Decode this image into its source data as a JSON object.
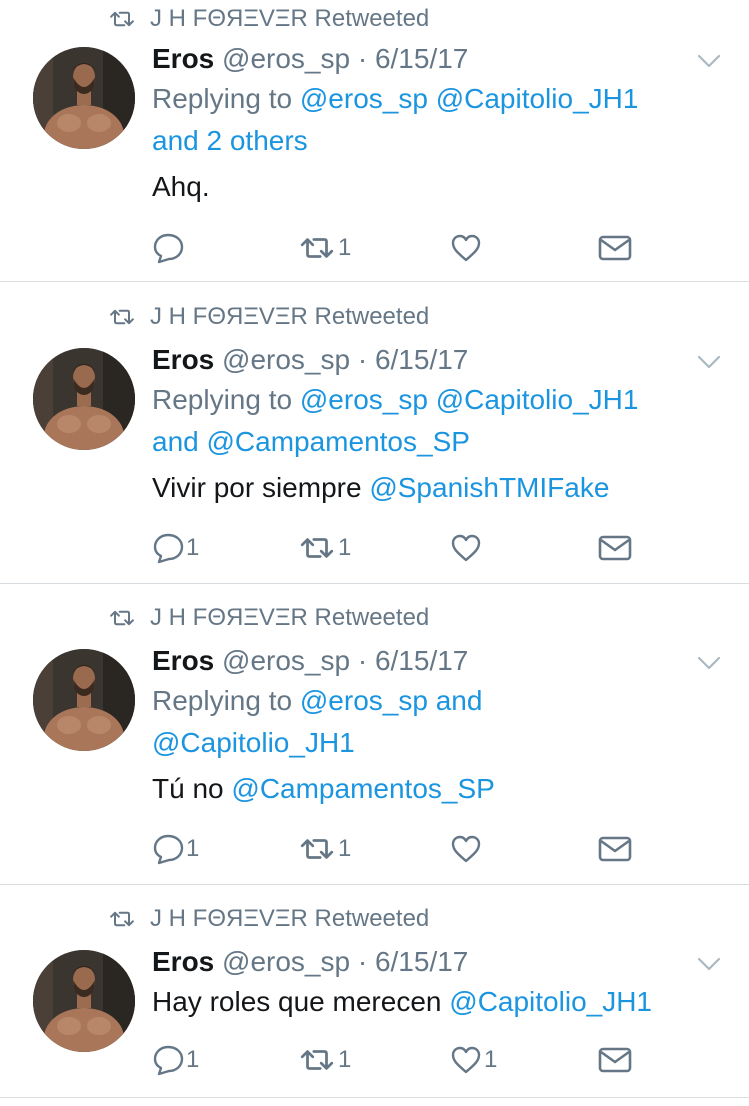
{
  "colors": {
    "link": "#1b95e0",
    "muted": "#657786",
    "text": "#14171a",
    "divider": "#d8dde2"
  },
  "tweets": [
    {
      "retweeted_by": "J H  FΘЯΞVΞR Retweeted",
      "name": "Eros",
      "meta": "@eros_sp · 6/15/17",
      "reply_prefix": "Replying to",
      "reply_line1": "@eros_sp @Capitolio_JH1",
      "reply_line2": "and 2 others",
      "body_text": "Ahq.",
      "body_mention": "",
      "counts": {
        "reply": "",
        "retweet": "1",
        "like": ""
      }
    },
    {
      "retweeted_by": "J H  FΘЯΞVΞR Retweeted",
      "name": "Eros",
      "meta": "@eros_sp · 6/15/17",
      "reply_prefix": "Replying to",
      "reply_line1": "@eros_sp @Capitolio_JH1",
      "reply_line2": "and @Campamentos_SP",
      "body_text": "Vivir por siempre ",
      "body_mention": "@SpanishTMIFake",
      "counts": {
        "reply": "1",
        "retweet": "1",
        "like": ""
      }
    },
    {
      "retweeted_by": "J H  FΘЯΞVΞR Retweeted",
      "name": "Eros",
      "meta": "@eros_sp · 6/15/17",
      "reply_prefix": "Replying to",
      "reply_line1": "@eros_sp and",
      "reply_line2": "@Capitolio_JH1",
      "body_text": "Tú no ",
      "body_mention": "@Campamentos_SP",
      "counts": {
        "reply": "1",
        "retweet": "1",
        "like": ""
      }
    },
    {
      "retweeted_by": "J H  FΘЯΞVΞR Retweeted",
      "name": "Eros",
      "meta": "@eros_sp · 6/15/17",
      "body_text": "Hay roles que merecen ",
      "body_mention": "@Capitolio_JH1",
      "counts": {
        "reply": "1",
        "retweet": "1",
        "like": "1"
      }
    }
  ]
}
